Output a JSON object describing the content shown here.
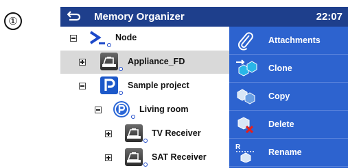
{
  "marker": "①",
  "header": {
    "back_icon": "back-arrow-icon",
    "title": "Memory Organizer",
    "time": "22:07"
  },
  "tree": {
    "items": [
      {
        "label": "Node",
        "icon": "node-icon",
        "expanded": false,
        "selected": false
      },
      {
        "label": "Appliance_FD",
        "icon": "appliance-icon",
        "expanded": false,
        "selected": true
      },
      {
        "label": "Sample project",
        "icon": "project-icon",
        "expanded": true,
        "selected": false
      },
      {
        "label": "Living room",
        "icon": "room-icon",
        "expanded": true,
        "selected": false
      },
      {
        "label": "TV Receiver",
        "icon": "appliance-icon",
        "expanded": false,
        "selected": false
      },
      {
        "label": "SAT Receiver",
        "icon": "appliance-icon",
        "expanded": false,
        "selected": false
      }
    ]
  },
  "sidebar": {
    "buttons": [
      {
        "label": "Attachments",
        "icon": "paperclip-icon"
      },
      {
        "label": "Clone",
        "icon": "clone-icon"
      },
      {
        "label": "Copy",
        "icon": "copy-icon"
      },
      {
        "label": "Delete",
        "icon": "delete-icon"
      },
      {
        "label": "Rename",
        "icon": "rename-icon"
      }
    ]
  },
  "colors": {
    "header": "#1e3f8c",
    "sidebar": "#2d63cf",
    "selected_row": "#d9d9d9",
    "cube": "#29b6e8",
    "delete_x": "#e02020"
  }
}
